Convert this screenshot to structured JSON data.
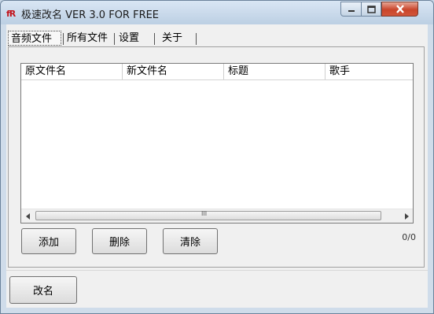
{
  "window": {
    "title": "极速改名 VER 3.0 FOR FREE",
    "app_icon": "fR"
  },
  "tabs": [
    {
      "label": "音频文件"
    },
    {
      "label": "所有文件"
    },
    {
      "label": "设置"
    },
    {
      "label": "关于"
    }
  ],
  "list": {
    "columns": [
      "原文件名",
      "新文件名",
      "标题",
      "歌手"
    ],
    "rows": []
  },
  "scrollbar": {
    "grip": "III"
  },
  "buttons": {
    "add": "添加",
    "delete": "删除",
    "clear": "清除",
    "rename": "改名"
  },
  "counter": "0/0",
  "icons": {
    "app": "app-logo-icon",
    "minimize": "minimize-icon",
    "maximize": "maximize-icon",
    "close": "close-icon"
  }
}
